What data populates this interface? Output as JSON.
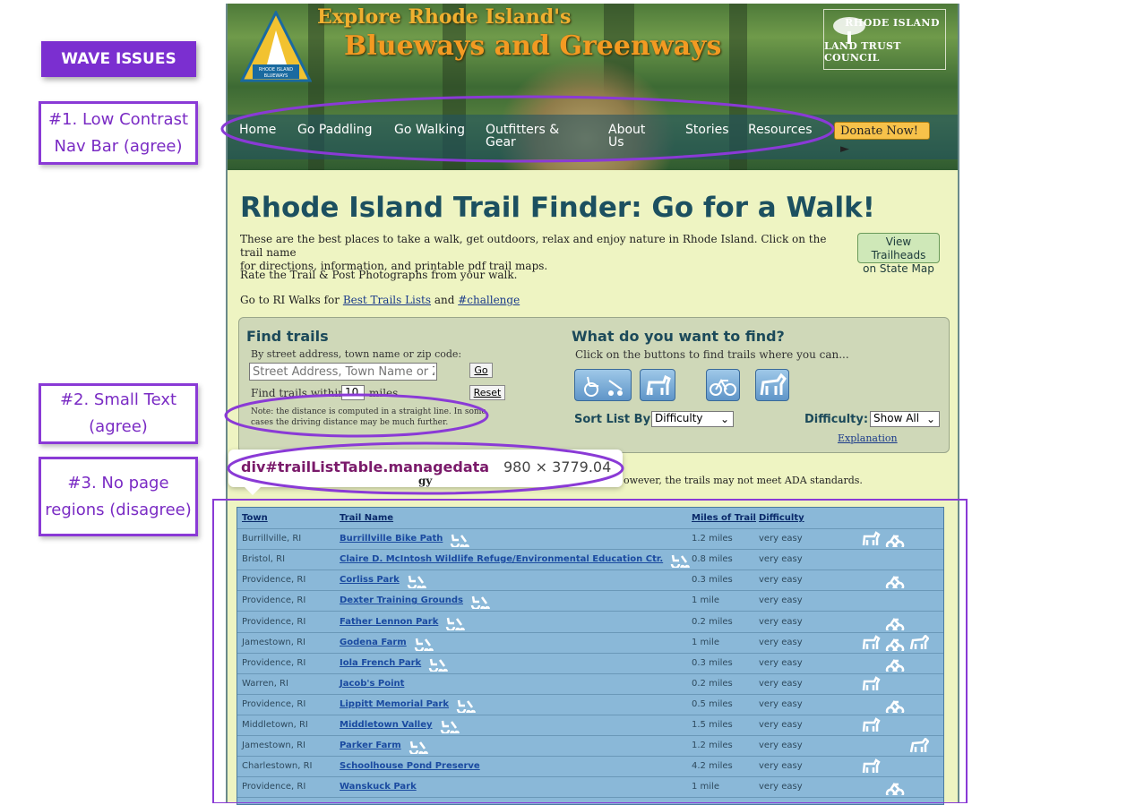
{
  "annotations": {
    "wave_issues": "WAVE ISSUES",
    "issue1_line1": "#1. Low Contrast",
    "issue1_line2": "Nav Bar (agree)",
    "issue2_line1": "#2. Small Text",
    "issue2_line2": "(agree)",
    "issue3_line1": "#3. No page",
    "issue3_line2": "regions (disagree)",
    "accent_color": "#7b2fd0"
  },
  "banner": {
    "title_line1": "Explore Rhode Island's",
    "title_line2": "Blueways and Greenways",
    "logo_line1": "RHODE ISLAND",
    "logo_line2": "BLUEWAYS",
    "partner_line1": "RHODE ISLAND",
    "partner_line2": "LAND TRUST COUNCIL"
  },
  "nav": {
    "items": [
      "Home",
      "Go Paddling",
      "Go Walking",
      "Outfitters &",
      "Gear",
      "About",
      "Us",
      "Stories",
      "Resources"
    ],
    "donate": "Donate Now! ►"
  },
  "main": {
    "title": "Rhode Island Trail Finder: Go for a Walk!",
    "intro_line1": "These are the best places to take a walk, get outdoors, relax and enjoy nature in Rhode Island. Click on the trail name",
    "intro_line2": "for directions, information, and printable pdf trail maps.",
    "rate": "Rate the Trail & Post Photographs from your walk.",
    "goto_prefix": "Go to RI Walks for ",
    "best_trails_link": "Best Trails Lists",
    "and": " and ",
    "challenge_link": "#challenge",
    "view_btn_line1": "View Trailheads",
    "view_btn_line2": "on State Map"
  },
  "finder": {
    "find_title": "Find trails",
    "by_label": "By street address, town name or zip code:",
    "address_placeholder": "Street Address, Town Name or Zip",
    "go": "Go",
    "within_prefix": "Find trails within",
    "within_value": "10",
    "within_suffix": "miles",
    "reset": "Reset",
    "note_line1": "Note: the distance is computed in a straight line. In some",
    "note_line2": "cases the driving distance may be much further.",
    "what_title": "What do you want to find?",
    "what_sub": "Click on the buttons to find trails where you can...",
    "sort_label": "Sort List By:",
    "sort_value": "Difficulty",
    "difficulty_label": "Difficulty:",
    "difficulty_value": "Show All",
    "explanation": "Explanation"
  },
  "inspector": {
    "tag": "div#trailListTable.managedata",
    "dims": "980 × 3779.04",
    "partial_text_left": "gy",
    "partial_text_right": "owever, the trails may not meet ADA standards."
  },
  "table": {
    "headers": [
      "Town",
      "Trail Name",
      "Miles of Trail",
      "Difficulty"
    ],
    "rows": [
      {
        "town": "Burrillville, RI",
        "trail": "Burrillville Bike Path",
        "access": true,
        "miles": "1.2 miles",
        "difficulty": "very easy",
        "dog": true,
        "bike": true,
        "horse": false
      },
      {
        "town": "Bristol, RI",
        "trail": "Claire D. McIntosh Wildlife Refuge/Environmental Education Ctr.",
        "access": true,
        "miles": "0.8 miles",
        "difficulty": "very easy",
        "dog": false,
        "bike": false,
        "horse": false
      },
      {
        "town": "Providence, RI",
        "trail": "Corliss Park",
        "access": true,
        "miles": "0.3 miles",
        "difficulty": "very easy",
        "dog": false,
        "bike": true,
        "horse": false
      },
      {
        "town": "Providence, RI",
        "trail": "Dexter Training Grounds",
        "access": true,
        "miles": "1 mile",
        "difficulty": "very easy",
        "dog": false,
        "bike": false,
        "horse": false
      },
      {
        "town": "Providence, RI",
        "trail": "Father Lennon Park",
        "access": true,
        "miles": "0.2 miles",
        "difficulty": "very easy",
        "dog": false,
        "bike": true,
        "horse": false
      },
      {
        "town": "Jamestown, RI",
        "trail": "Godena Farm",
        "access": true,
        "miles": "1 mile",
        "difficulty": "very easy",
        "dog": true,
        "bike": true,
        "horse": true
      },
      {
        "town": "Providence, RI",
        "trail": "Iola French Park",
        "access": true,
        "miles": "0.3 miles",
        "difficulty": "very easy",
        "dog": false,
        "bike": true,
        "horse": false
      },
      {
        "town": "Warren, RI",
        "trail": "Jacob's Point",
        "access": false,
        "miles": "0.2 miles",
        "difficulty": "very easy",
        "dog": true,
        "bike": false,
        "horse": false
      },
      {
        "town": "Providence, RI",
        "trail": "Lippitt Memorial Park",
        "access": true,
        "miles": "0.5 miles",
        "difficulty": "very easy",
        "dog": false,
        "bike": true,
        "horse": false
      },
      {
        "town": "Middletown, RI",
        "trail": "Middletown Valley",
        "access": true,
        "miles": "1.5 miles",
        "difficulty": "very easy",
        "dog": true,
        "bike": false,
        "horse": false
      },
      {
        "town": "Jamestown, RI",
        "trail": "Parker Farm",
        "access": true,
        "miles": "1.2 miles",
        "difficulty": "very easy",
        "dog": false,
        "bike": false,
        "horse": true
      },
      {
        "town": "Charlestown, RI",
        "trail": "Schoolhouse Pond Preserve",
        "access": false,
        "miles": "4.2 miles",
        "difficulty": "very easy",
        "dog": true,
        "bike": false,
        "horse": false
      },
      {
        "town": "Providence, RI",
        "trail": "Wanskuck Park",
        "access": false,
        "miles": "1 mile",
        "difficulty": "very easy",
        "dog": false,
        "bike": true,
        "horse": false
      }
    ]
  }
}
